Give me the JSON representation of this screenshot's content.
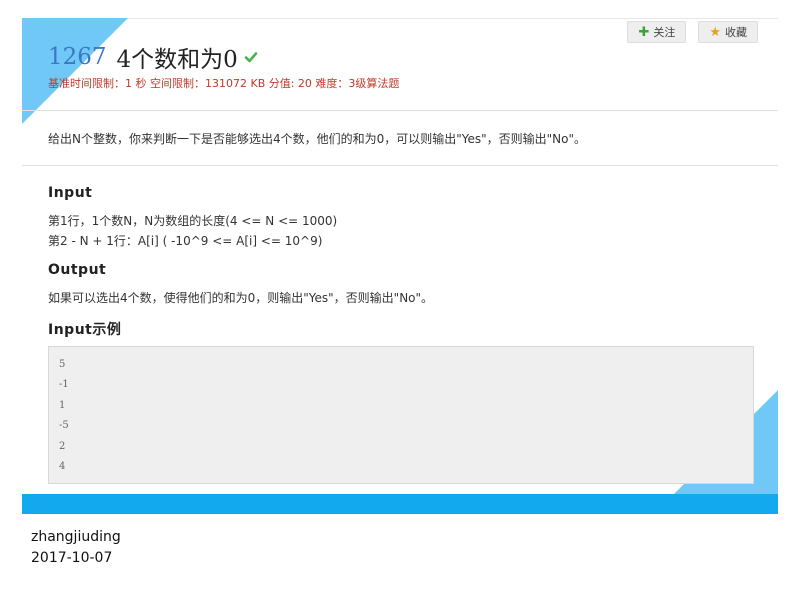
{
  "problem": {
    "id": "1267",
    "title": "4个数和为0",
    "meta": "基准时间限制：1 秒 空间限制：131072 KB 分值: 20 难度：3级算法题",
    "description": "给出N个整数，你来判断一下是否能够选出4个数，他们的和为0，可以则输出\"Yes\"，否则输出\"No\"。"
  },
  "actions": {
    "follow_label": "关注",
    "collect_label": "收藏"
  },
  "sections": {
    "input_heading": "Input",
    "input_lines": [
      "第1行，1个数N，N为数组的长度(4 <= N <= 1000)",
      "第2 - N + 1行：A[i] ( -10^9 <= A[i] <= 10^9)"
    ],
    "output_heading": "Output",
    "output_line": "如果可以选出4个数，使得他们的和为0，则输出\"Yes\"，否则输出\"No\"。",
    "sample_heading": "Input示例",
    "sample_lines": [
      "5",
      "-1",
      "1",
      "-5",
      "2",
      "4"
    ]
  },
  "footer": {
    "author": "zhangjiuding",
    "date": "2017-10-07"
  },
  "colors": {
    "accent_blue": "#12a9ee",
    "corner_blue": "#6fc8f5",
    "meta_red": "#c0392b",
    "id_blue": "#3a78c3"
  },
  "icons": {
    "check": "check-icon",
    "plus": "plus-icon",
    "star": "star-icon"
  }
}
